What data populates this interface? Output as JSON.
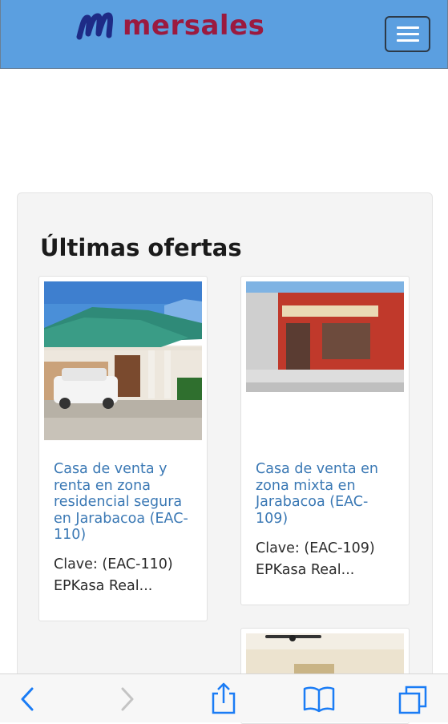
{
  "header": {
    "logo_text": "mersales",
    "menu_icon": "hamburger-menu-icon",
    "colors": {
      "bar": "#5b9fe0",
      "logo_mark": "#1e2b86",
      "logo_text": "#9b1a3f"
    }
  },
  "offers": {
    "title": "Últimas ofertas",
    "items": [
      {
        "image": "house-photo-teal-roof",
        "title": "Casa de venta y renta en zona residencial segura en Jarabacoa (EAC-110)",
        "clave": "Clave: (EAC-110)",
        "agency": "EPKasa Real..."
      },
      {
        "image": "house-photo-red-facade",
        "title": "Casa de venta en zona mixta en Jarabacoa (EAC-109)",
        "clave": "Clave: (EAC-109)",
        "agency": "EPKasa Real..."
      },
      {
        "image": "interior-photo-ceiling-fan"
      }
    ]
  },
  "browser_toolbar": {
    "icons": [
      "back-icon",
      "forward-icon",
      "share-icon",
      "bookmarks-icon",
      "tabs-icon"
    ],
    "accent": "#1a7cf5"
  }
}
